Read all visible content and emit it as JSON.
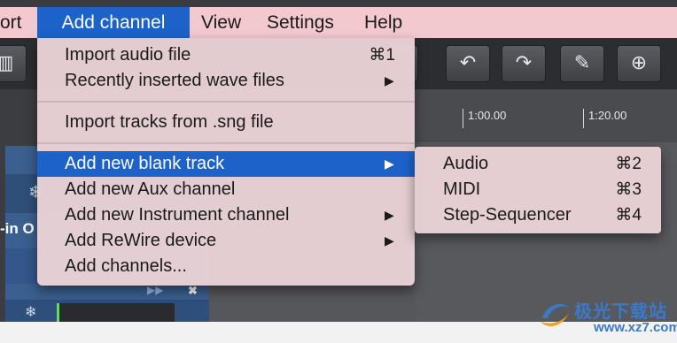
{
  "menubar": {
    "items": [
      {
        "label": "ort"
      },
      {
        "label": "Add channel"
      },
      {
        "label": "View"
      },
      {
        "label": "Settings"
      },
      {
        "label": "Help"
      }
    ]
  },
  "add_channel_menu": {
    "items": [
      {
        "label": "Import audio file",
        "shortcut": "⌘1",
        "has_submenu": false
      },
      {
        "label": "Recently inserted wave files",
        "shortcut": "",
        "has_submenu": true
      },
      {
        "label": "Import tracks from .sng file",
        "shortcut": "",
        "has_submenu": false
      },
      {
        "label": "Add new blank track",
        "shortcut": "",
        "has_submenu": true,
        "highlighted": true
      },
      {
        "label": "Add new Aux channel",
        "shortcut": "",
        "has_submenu": false
      },
      {
        "label": "Add new Instrument channel",
        "shortcut": "",
        "has_submenu": true
      },
      {
        "label": "Add ReWire device",
        "shortcut": "",
        "has_submenu": true
      },
      {
        "label": "Add channels...",
        "shortcut": "",
        "has_submenu": false
      }
    ],
    "arrow_glyph": "▶"
  },
  "blank_track_submenu": {
    "items": [
      {
        "label": "Audio",
        "shortcut": "⌘2"
      },
      {
        "label": "MIDI",
        "shortcut": "⌘3"
      },
      {
        "label": "Step-Sequencer",
        "shortcut": "⌘4"
      }
    ]
  },
  "timeline": {
    "markers": [
      "1:00.00",
      "1:20.00"
    ]
  },
  "track_panel": {
    "label_fragment": "-in O"
  },
  "toolbar": {
    "icons": [
      "mixer-icon",
      "tempo-icon",
      "undo-icon",
      "redo-icon",
      "edit-icon",
      "drum-add-icon"
    ]
  },
  "watermark": {
    "title": "极光下载站",
    "url": "www.xz7.com"
  },
  "colors": {
    "menubar_bg": "#f2c9cf",
    "highlight": "#1d62c9",
    "menu_bg": "#e8d2d6",
    "app_bg": "#3a3b3e"
  }
}
